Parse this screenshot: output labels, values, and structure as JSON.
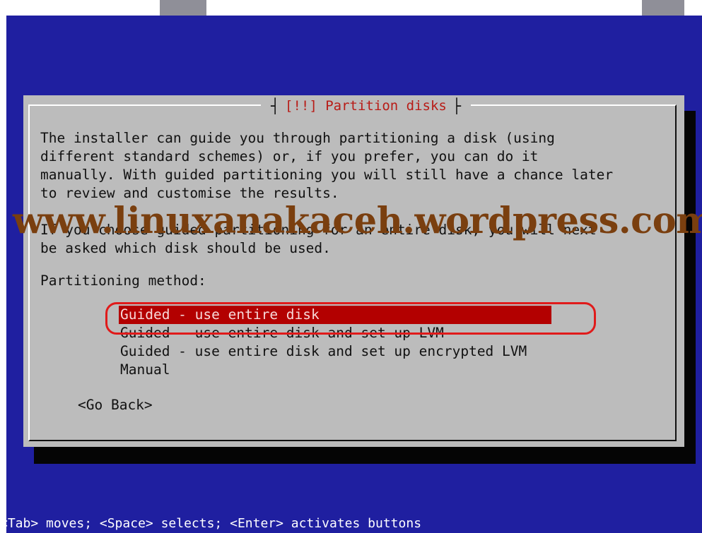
{
  "dialog": {
    "title": "[!!] Partition disks",
    "body": [
      "The installer can guide you through partitioning a disk (using",
      "different standard schemes) or, if you prefer, you can do it",
      "manually. With guided partitioning you will still have a chance later",
      "to review and customise the results."
    ],
    "body2": [
      "If you choose guided partitioning for an entire disk, you will next",
      "be asked which disk should be used."
    ],
    "method_label": "Partitioning method:",
    "options": [
      "Guided - use entire disk",
      "Guided - use entire disk and set up LVM",
      "Guided - use entire disk and set up encrypted LVM",
      "Manual"
    ],
    "selected_option": "Guided - use entire disk",
    "go_back": "<Go Back>"
  },
  "watermark": "www.linuxanakaceh.wordpress.com",
  "status_bar": "<Tab> moves; <Space> selects; <Enter> activates buttons",
  "colors": {
    "background": "#1f1fa0",
    "dialog": "#bcbcbc",
    "selection": "#b30000",
    "title": "#b81b16",
    "highlight_ring": "#e01a1a",
    "watermark": "#7a3f0f"
  }
}
